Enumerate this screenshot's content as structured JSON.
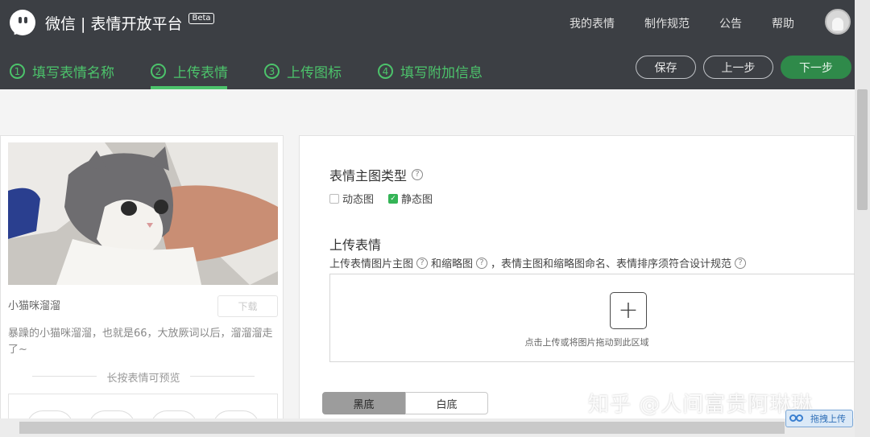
{
  "brand": {
    "name": "微信 | 表情开放平台",
    "badge": "Beta"
  },
  "topnav": [
    "我的表情",
    "制作规范",
    "公告",
    "帮助"
  ],
  "steps": [
    {
      "num": "1",
      "label": "填写表情名称"
    },
    {
      "num": "2",
      "label": "上传表情"
    },
    {
      "num": "3",
      "label": "上传图标"
    },
    {
      "num": "4",
      "label": "填写附加信息"
    }
  ],
  "active_step": "2",
  "actions": {
    "save": "保存",
    "prev": "上一步",
    "next": "下一步"
  },
  "preview": {
    "name": "小猫咪溜溜",
    "download": "下载",
    "description": "暴躁的小猫咪溜溜，也就是66，大放厥词以后，溜溜溜走了~",
    "hint": "长按表情可预览"
  },
  "form": {
    "type_title": "表情主图类型",
    "help": "?",
    "options": [
      {
        "label": "动态图",
        "checked": false
      },
      {
        "label": "静态图",
        "checked": true
      }
    ],
    "upload_title": "上传表情",
    "upload_desc_1": "上传表情图片主图",
    "upload_desc_2": "和缩略图",
    "upload_desc_3": "，表情主图和缩略图命名、表情排序须符合设计规范",
    "plus": "+",
    "drop_text": "点击上传或将图片拖动到此区域",
    "bg_options": [
      "黑底",
      "白底"
    ]
  },
  "watermark": "知乎 @人间富贵阿琳琳",
  "baidu_upload": "拖拽上传",
  "colors": {
    "accent": "#4cc36b",
    "topbar": "#3c3f44"
  }
}
